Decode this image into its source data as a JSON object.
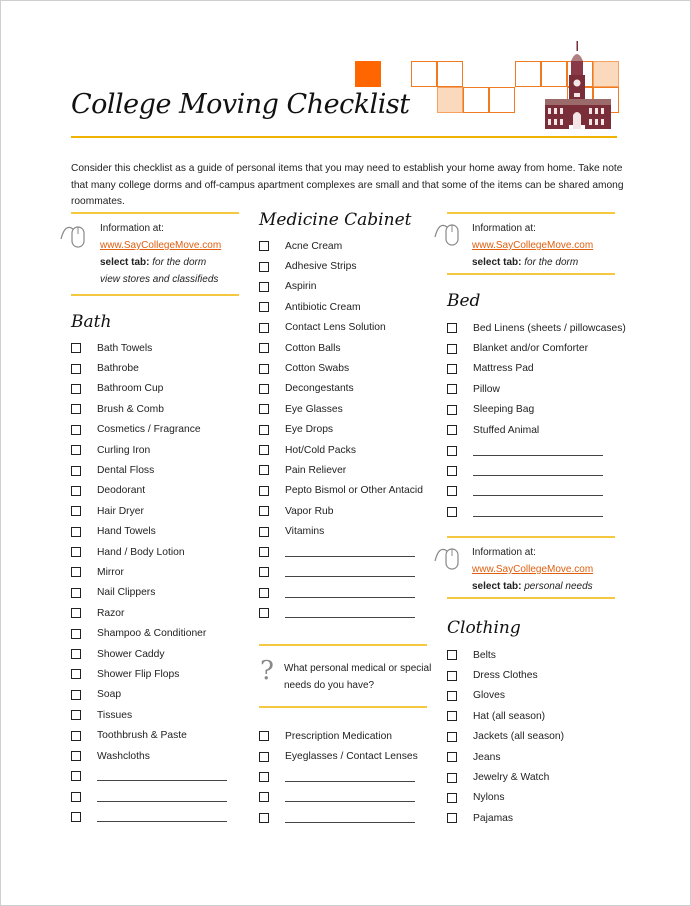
{
  "document": {
    "title": "College Moving Checklist",
    "intro": "Consider this checklist as a guide of personal items that you may need to establish your home away from home.  Take note that many college dorms and off-campus apartment complexes are small and that some of the items can be shared among roommates.",
    "colors": {
      "accent_orange": "#ff6600",
      "rule_gold": "#f0b400",
      "link": "#e06010",
      "building": "#7a2e3a"
    }
  },
  "info_boxes": [
    {
      "label": "Information at:",
      "link": "www.SayCollegeMove.com",
      "tab_label": "select tab:",
      "tab_value": "for the dorm",
      "extra": "view stores and classifieds",
      "icon": "mouse-icon"
    },
    {
      "label": "Information at:",
      "link": "www.SayCollegeMove.com",
      "tab_label": "select tab:",
      "tab_value": "for the dorm",
      "icon": "mouse-icon"
    },
    {
      "label": "Information at:",
      "link": "www.SayCollegeMove.com",
      "tab_label": "select tab:",
      "tab_value": "personal needs",
      "icon": "mouse-icon"
    }
  ],
  "sections": {
    "bath": {
      "title": "Bath",
      "items": [
        "Bath Towels",
        "Bathrobe",
        "Bathroom Cup",
        "Brush & Comb",
        "Cosmetics / Fragrance",
        "Curling Iron",
        "Dental Floss",
        "Deodorant",
        "Hair Dryer",
        "Hand Towels",
        "Hand / Body Lotion",
        "Mirror",
        "Nail Clippers",
        "Razor",
        "Shampoo & Conditioner",
        "Shower Caddy",
        "Shower Flip Flops",
        "Soap",
        "Tissues",
        "Toothbrush & Paste",
        "Washcloths"
      ],
      "blank_lines": 3
    },
    "medicine": {
      "title": "Medicine Cabinet",
      "items": [
        "Acne Cream",
        "Adhesive Strips",
        "Aspirin",
        "Antibiotic Cream",
        "Contact Lens Solution",
        "Cotton Balls",
        "Cotton Swabs",
        "Decongestants",
        "Eye Glasses",
        "Eye Drops",
        "Hot/Cold Packs",
        "Pain Reliever",
        "Pepto Bismol or Other Antacid",
        "Vapor Rub",
        "Vitamins"
      ],
      "blank_lines": 4
    },
    "special_needs": {
      "question": "What personal medical or special needs do you have?",
      "icon": "question-mark-icon",
      "items": [
        "Prescription Medication",
        "Eyeglasses / Contact Lenses"
      ],
      "blank_lines": 3
    },
    "bed": {
      "title": "Bed",
      "items": [
        "Bed Linens (sheets / pillowcases)",
        "Blanket and/or Comforter",
        "Mattress Pad",
        "Pillow",
        "Sleeping Bag",
        "Stuffed Animal"
      ],
      "blank_lines": 4
    },
    "clothing": {
      "title": "Clothing",
      "items": [
        "Belts",
        "Dress Clothes",
        "Gloves",
        "Hat (all season)",
        "Jackets (all season)",
        "Jeans",
        "Jewelry & Watch",
        "Nylons",
        "Pajamas"
      ],
      "blank_lines": 0
    }
  }
}
